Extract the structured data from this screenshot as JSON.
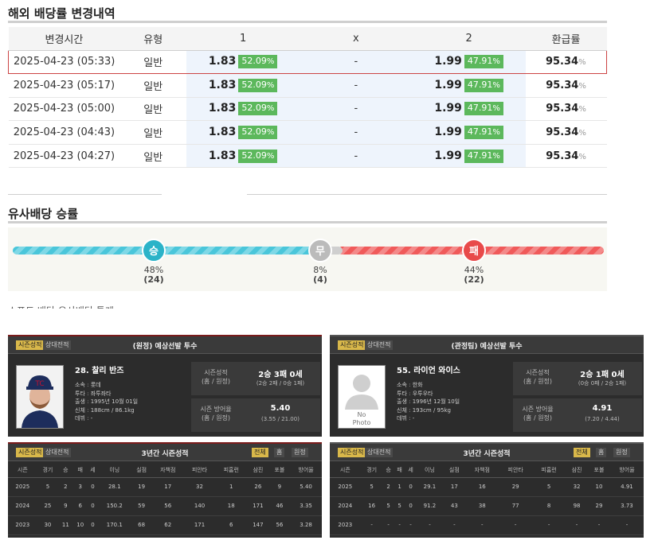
{
  "odds_section": {
    "title": "해외 배당률 변경내역",
    "headers": [
      "변경시간",
      "유형",
      "1",
      "x",
      "2",
      "환급률"
    ],
    "rows": [
      {
        "time": "2025-04-23 (05:33)",
        "type": "일반",
        "o1": "1.83",
        "p1": "52.09",
        "x": "-",
        "o2": "1.99",
        "p2": "47.91",
        "ret": "95.34"
      },
      {
        "time": "2025-04-23 (05:17)",
        "type": "일반",
        "o1": "1.83",
        "p1": "52.09",
        "x": "-",
        "o2": "1.99",
        "p2": "47.91",
        "ret": "95.34"
      },
      {
        "time": "2025-04-23 (05:00)",
        "type": "일반",
        "o1": "1.83",
        "p1": "52.09",
        "x": "-",
        "o2": "1.99",
        "p2": "47.91",
        "ret": "95.34"
      },
      {
        "time": "2025-04-23 (04:43)",
        "type": "일반",
        "o1": "1.83",
        "p1": "52.09",
        "x": "-",
        "o2": "1.99",
        "p2": "47.91",
        "ret": "95.34"
      },
      {
        "time": "2025-04-23 (04:27)",
        "type": "일반",
        "o1": "1.83",
        "p1": "52.09",
        "x": "-",
        "o2": "1.99",
        "p2": "47.91",
        "ret": "95.34"
      }
    ],
    "percent_sign": "%"
  },
  "similar": {
    "title": "유사배당 승률",
    "win": {
      "label": "승",
      "pct": "48%",
      "count": "(24)"
    },
    "draw": {
      "label": "무",
      "pct": "8%",
      "count": "(4)"
    },
    "loss": {
      "label": "패",
      "pct": "44%",
      "count": "(22)"
    }
  },
  "hidden_heading": "소프트 배당 유사배당 통계",
  "left": {
    "tabs": [
      "시즌성적",
      "상대전적"
    ],
    "title": "(원정) 예상선발 투수",
    "name": "28. 찰리 반즈",
    "info": [
      [
        "소속",
        "롯데"
      ],
      [
        "투타",
        "좌투좌타"
      ],
      [
        "출생",
        "1995년 10월 01일"
      ],
      [
        "신체",
        "188cm / 86.1kg"
      ],
      [
        "데뷔",
        "-"
      ]
    ],
    "record_k1": "시즌성적",
    "record_k2": "(홈 / 원정)",
    "record_v": "2승 3패 0세",
    "record_s": "(2승 2패 / 0승 1패)",
    "era_k1": "시즌 방어율",
    "era_k2": "(홈 / 원정)",
    "era_v": "5.40",
    "era_s": "(3.55 / 21.00)",
    "stats_title": "3년간 시즌성적",
    "filters": [
      "전체",
      "홈",
      "원정"
    ],
    "cols": [
      "시즌",
      "경기",
      "승",
      "패",
      "세",
      "이닝",
      "실점",
      "자책점",
      "피안타",
      "피홈런",
      "삼진",
      "포볼",
      "방어율"
    ],
    "rows": [
      [
        "2025",
        "5",
        "2",
        "3",
        "0",
        "28.1",
        "19",
        "17",
        "32",
        "1",
        "26",
        "9",
        "5.40"
      ],
      [
        "2024",
        "25",
        "9",
        "6",
        "0",
        "150.2",
        "59",
        "56",
        "140",
        "18",
        "171",
        "46",
        "3.35"
      ],
      [
        "2023",
        "30",
        "11",
        "10",
        "0",
        "170.1",
        "68",
        "62",
        "171",
        "6",
        "147",
        "56",
        "3.28"
      ]
    ]
  },
  "right": {
    "tabs": [
      "시즌성적",
      "상대전적"
    ],
    "title": "(관정팀) 예상선발 투수",
    "name": "55. 라이언 와이스",
    "nophoto": "No Photo",
    "info": [
      [
        "소속",
        "한화"
      ],
      [
        "투타",
        "우투우타"
      ],
      [
        "출생",
        "1996년 12월 10일"
      ],
      [
        "신체",
        "193cm / 95kg"
      ],
      [
        "데뷔",
        "-"
      ]
    ],
    "record_k1": "시즌성적",
    "record_k2": "(홈 / 원정)",
    "record_v": "2승 1패 0세",
    "record_s": "(0승 0패 / 2승 1패)",
    "era_k1": "시즌 방어율",
    "era_k2": "(홈 / 원정)",
    "era_v": "4.91",
    "era_s": "(7.20 / 4.44)",
    "stats_title": "3년간 시즌성적",
    "filters": [
      "전체",
      "홈",
      "원정"
    ],
    "cols": [
      "시즌",
      "경기",
      "승",
      "패",
      "세",
      "이닝",
      "실점",
      "자책점",
      "피안타",
      "피홈런",
      "삼진",
      "포볼",
      "방어율"
    ],
    "rows": [
      [
        "2025",
        "5",
        "2",
        "1",
        "0",
        "29.1",
        "17",
        "16",
        "29",
        "5",
        "32",
        "10",
        "4.91"
      ],
      [
        "2024",
        "16",
        "5",
        "5",
        "0",
        "91.2",
        "43",
        "38",
        "77",
        "8",
        "98",
        "29",
        "3.73"
      ],
      [
        "2023",
        "-",
        "-",
        "-",
        "-",
        "-",
        "-",
        "-",
        "-",
        "-",
        "-",
        "-",
        "-"
      ]
    ]
  }
}
